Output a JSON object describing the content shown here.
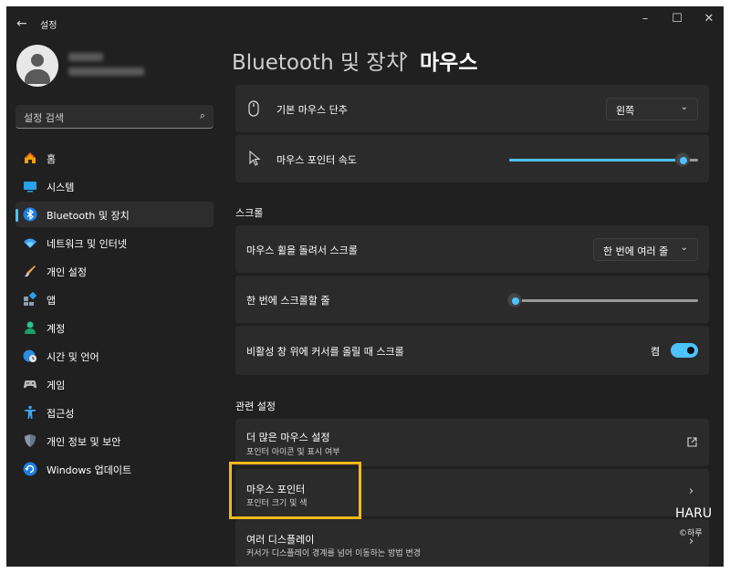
{
  "app": {
    "title": "설정"
  },
  "search": {
    "placeholder": "설정 검색"
  },
  "sidebar": {
    "items": [
      {
        "label": "홈",
        "icon": "home-icon"
      },
      {
        "label": "시스템",
        "icon": "system-icon"
      },
      {
        "label": "Bluetooth 및 장치",
        "icon": "bluetooth-icon",
        "active": true
      },
      {
        "label": "네트워크 및 인터넷",
        "icon": "network-icon"
      },
      {
        "label": "개인 설정",
        "icon": "brush-icon"
      },
      {
        "label": "앱",
        "icon": "apps-icon"
      },
      {
        "label": "계정",
        "icon": "account-icon"
      },
      {
        "label": "시간 및 언어",
        "icon": "globe-clock-icon"
      },
      {
        "label": "게임",
        "icon": "gamepad-icon"
      },
      {
        "label": "접근성",
        "icon": "accessibility-icon"
      },
      {
        "label": "개인 정보 및 보안",
        "icon": "shield-icon"
      },
      {
        "label": "Windows 업데이트",
        "icon": "update-icon"
      }
    ]
  },
  "header": {
    "root": "Bluetooth 및 장치",
    "separator": "›",
    "current": "마우스"
  },
  "main": {
    "primary_button": {
      "label": "기본 마우스 단추",
      "value": "왼쪽"
    },
    "pointer_speed": {
      "label": "마우스 포인터 속도",
      "level": 0.92
    },
    "scroll_section": "스크롤",
    "wheel_scroll": {
      "label": "마우스 휠을 돌려서 스크롤",
      "value": "한 번에 여러 줄"
    },
    "lines_scroll": {
      "label": "한 번에 스크롤할 줄",
      "level": 0.03
    },
    "inactive_scroll": {
      "label": "비활성 창 위에 커서를 올릴 때 스크롤",
      "state": "켬"
    },
    "related_section": "관련 설정",
    "related": [
      {
        "label": "더 많은 마우스 설정",
        "sub": "포인터 아이콘 및 표시 여부"
      },
      {
        "label": "마우스 포인터",
        "sub": "포인터 크기 및 색"
      },
      {
        "label": "여러 디스플레이",
        "sub": "커서가 디스플레이 경계를 넘어 이동하는 방법 변경"
      }
    ]
  },
  "watermark": {
    "line1": "HARU",
    "line2": "©하루"
  },
  "colors": {
    "accent": "#4cc2ff",
    "highlight": "#f5b91b",
    "background": "#202020",
    "card": "#2b2b2b"
  }
}
